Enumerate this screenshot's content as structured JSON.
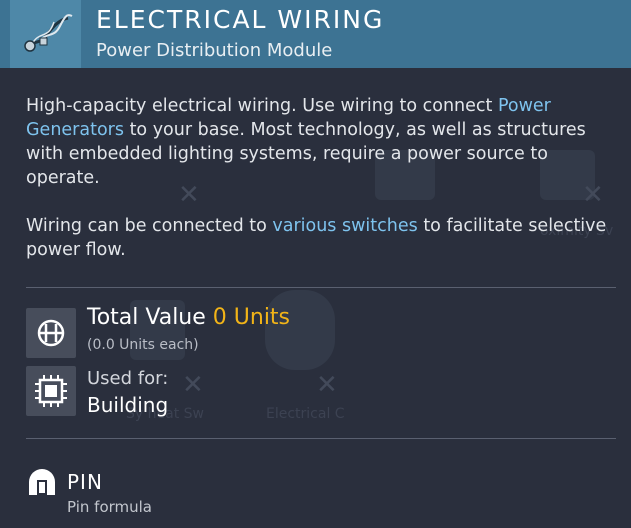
{
  "header": {
    "title": "ELECTRICAL WIRING",
    "subtitle": "Power Distribution Module",
    "icon": "electrical-wiring-icon"
  },
  "description": {
    "p1_before": "High-capacity electrical wiring. Use wiring to connect ",
    "p1_link": "Power Generators",
    "p1_after": " to your base. Most technology, as well as structures with embedded lighting systems, require a power source to operate.",
    "p2_before": "Wiring can be connected to ",
    "p2_link": "various switches",
    "p2_after": " to facilitate selective power flow."
  },
  "value": {
    "label": "Total Value ",
    "amount": "0 Units",
    "each": "(0.0 Units each)",
    "icon": "units-currency-icon"
  },
  "usage": {
    "label": "Used for:",
    "value": "Building",
    "icon": "chip-icon"
  },
  "pin": {
    "label": "PIN",
    "sub": "Pin formula",
    "icon": "pin-icon"
  },
  "background_ghosts": {
    "item_a": "oximity Sv",
    "item_b": "Sy  heat Sw",
    "item_c": "Electrical C"
  },
  "colors": {
    "header": "#3d7393",
    "accent_link": "#7ec3ee",
    "units": "#f2b418",
    "panel": "#2a2f3d"
  }
}
